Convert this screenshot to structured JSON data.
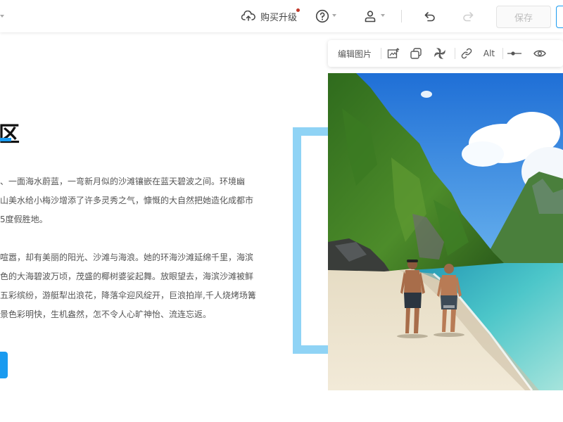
{
  "toolbar": {
    "upgrade_label": "购买升级",
    "save_label": "保存"
  },
  "content": {
    "heading": "区",
    "paragraph1": [
      "、一面海水蔚蓝，一弯新月似的沙滩镶嵌在蓝天碧波之间。环境幽",
      "山美水给小梅沙增添了许多灵秀之气，慷慨的大自然把她造化成都市",
      "5度假胜地。"
    ],
    "paragraph2": [
      "喧嚣，却有美丽的阳光、沙滩与海浪。她的环海沙滩延绵千里，海滨",
      "色的大海碧波万顷，茂盛的椰树婆娑起舞。放眼望去，海滨沙滩被鲜",
      "五彩缤纷，游艇犁出浪花，降落伞迎风绽开，巨浪拍岸,千人烧烤场篝",
      "景色彩明快，生机盎然，怎不令人心旷神怡、流连忘返。"
    ]
  },
  "image_toolbar": {
    "edit_label": "编辑图片",
    "alt_label": "Alt"
  },
  "colors": {
    "accent": "#1a9bf0",
    "frame": "#8fd3f5",
    "notification": "#c0392b"
  },
  "icons": [
    "chevron-down-icon",
    "cloud-upload-icon",
    "help-icon",
    "user-icon",
    "undo-icon",
    "redo-icon",
    "crop-icon",
    "mask-shape-icon",
    "fan-effect-icon",
    "link-icon",
    "slider-icon",
    "eye-icon"
  ]
}
